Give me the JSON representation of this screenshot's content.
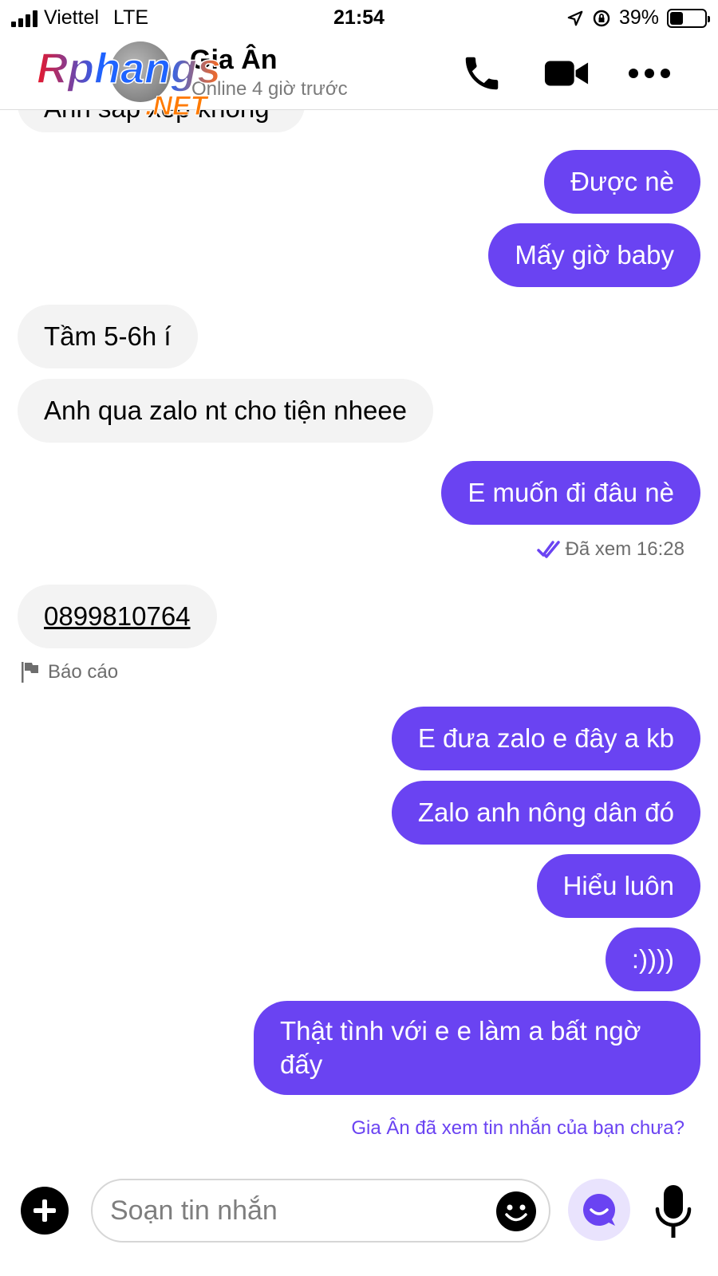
{
  "status_bar": {
    "carrier": "Viettel",
    "network": "LTE",
    "time": "21:54",
    "battery": "39%",
    "battery_level": 0.39
  },
  "header": {
    "contact_name": "Gia Ân",
    "contact_status": "Online 4 giờ trước",
    "watermark_line1": "Rphangs",
    "watermark_line2": ".NET"
  },
  "messages": {
    "partial_text": "Anh sắp xếp không",
    "m1": "Được nè",
    "m2": "Mấy giờ baby",
    "m3": "Tầm 5-6h í",
    "m4": "Anh qua zalo nt cho tiện nheee",
    "m5": "E muốn đi đâu nè",
    "seen": "Đã xem 16:28",
    "m6": "0899810764",
    "report": "Báo cáo",
    "m7": "E đưa zalo e đây a kb",
    "m8": "Zalo anh nông dân đó",
    "m9": "Hiểu luôn",
    "m10": ":))))",
    "m11": "Thật tình với e e làm a bất ngờ đấy",
    "ask_seen": "Gia Ân đã xem tin nhắn của bạn chưa?"
  },
  "composer": {
    "placeholder": "Soạn tin nhắn"
  },
  "colors": {
    "accent": "#6a43f2",
    "incoming_bg": "#f3f3f3"
  }
}
